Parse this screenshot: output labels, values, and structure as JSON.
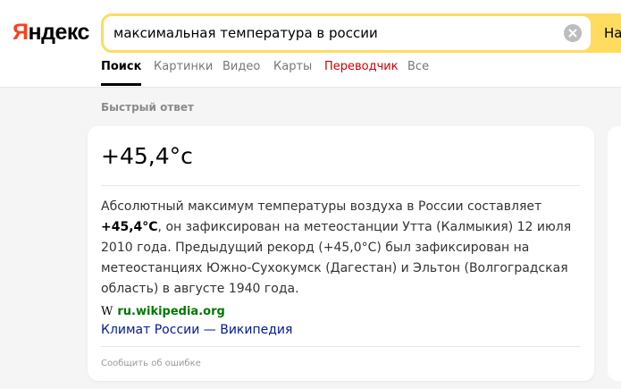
{
  "logo": {
    "first": "Я",
    "rest": "ндекс"
  },
  "search": {
    "query": "максимальная температура в россии",
    "button_label": "На"
  },
  "tabs": [
    {
      "label": "Поиск",
      "active": true
    },
    {
      "label": "Картинки"
    },
    {
      "label": "Видео"
    },
    {
      "label": "Карты"
    },
    {
      "label": "Переводчик",
      "color": "#cc0000"
    },
    {
      "label": "Все"
    }
  ],
  "quick_answer": {
    "section_label": "Быстрый ответ",
    "answer": "+45,4°c",
    "description_before": "Абсолютный максимум температуры воздуха в России составляет ",
    "description_bold": "+45,4°C",
    "description_after": ", он зафиксирован на метеостанции Утта (Калмыкия) 12 июля 2010 года. Предыдущий рекорд (+45,0°C) был зафиксирован на метеостанциях Южно-Сухокумск (Дагестан) и Эльтон (Волгоградская область) в августе 1940 года.",
    "source_icon": "W",
    "source_domain": "ru.wikipedia.org",
    "source_title": "Климат России — Википедия",
    "report_label": "Сообщить об ошибке"
  },
  "colors": {
    "brand_red": "#fc3f1d",
    "search_yellow": "#ffdc60",
    "link_blue": "#001a99",
    "domain_green": "#007700"
  }
}
